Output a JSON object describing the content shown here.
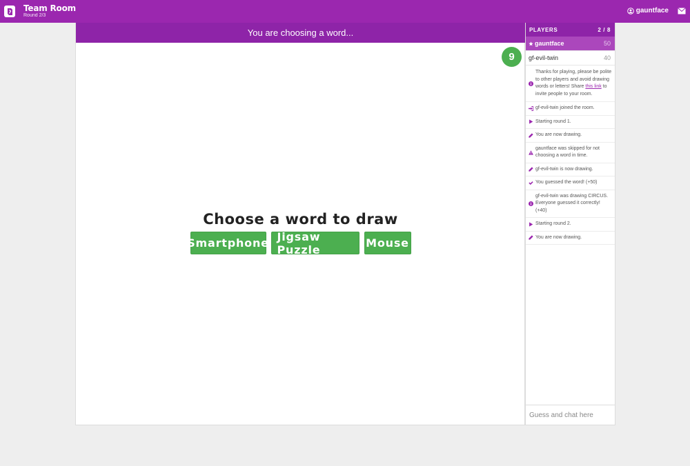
{
  "header": {
    "room_title": "Team Room",
    "round_label": "Round 2/3",
    "username": "gauntface",
    "brand_color": "#9b27af"
  },
  "game": {
    "status_text": "You are choosing a word...",
    "timer": "9",
    "choose_title": "Choose a word to draw",
    "words": [
      "Smartphone",
      "Jigsaw Puzzle",
      "Mouse"
    ]
  },
  "players": {
    "header_label": "PLAYERS",
    "count": "2 / 8",
    "list": [
      {
        "name": "gauntface",
        "score": "50",
        "active": true
      },
      {
        "name": "gf-evil-twin",
        "score": "40",
        "active": false
      }
    ]
  },
  "messages": [
    {
      "icon": "info-icon",
      "text_before": "Thanks for playing, please be polite to other players and avoid drawing words or letters! Share ",
      "link": "this link",
      "text_after": " to invite people to your room."
    },
    {
      "icon": "sign-in-icon",
      "text": "gf-evil-twin joined the room."
    },
    {
      "icon": "play-icon",
      "text": "Starting round 1."
    },
    {
      "icon": "pencil-icon",
      "text": "You are now drawing."
    },
    {
      "icon": "warning-icon",
      "text": "gauntface was skipped for not choosing a word in time."
    },
    {
      "icon": "pencil-icon",
      "text": "gf-evil-twin is now drawing."
    },
    {
      "icon": "check-icon",
      "text": "You guessed the word! (+50)"
    },
    {
      "icon": "info-icon",
      "text": "gf-evil-twin was drawing CIRCUS. Everyone guessed it correctly! (+40)"
    },
    {
      "icon": "play-icon",
      "text": "Starting round 2."
    },
    {
      "icon": "pencil-icon",
      "text": "You are now drawing."
    }
  ],
  "chat": {
    "placeholder": "Guess and chat here"
  }
}
